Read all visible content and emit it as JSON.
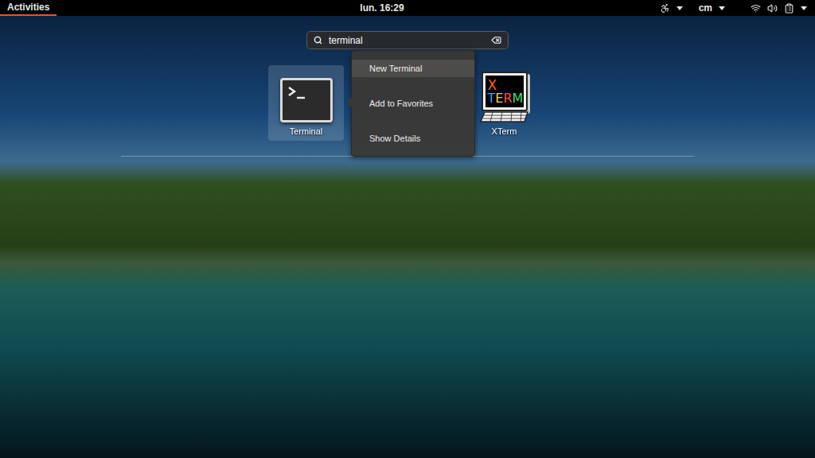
{
  "top_bar": {
    "activities": "Activities",
    "activities_selected": true,
    "clock": "lun. 16:29",
    "keyboard_layout": "cm"
  },
  "search": {
    "query": "terminal"
  },
  "results": [
    {
      "label": "Terminal",
      "kind": "terminal",
      "selected": true
    },
    {
      "label": "XTerm",
      "kind": "xterm",
      "selected": false,
      "icon_text": {
        "top": "X",
        "bottom": "TERM"
      }
    }
  ],
  "context_menu": {
    "items": [
      {
        "label": "New Terminal",
        "selected": true
      },
      {
        "label": "Add to Favorites",
        "selected": false
      },
      {
        "label": "Show Details",
        "selected": false
      }
    ]
  }
}
